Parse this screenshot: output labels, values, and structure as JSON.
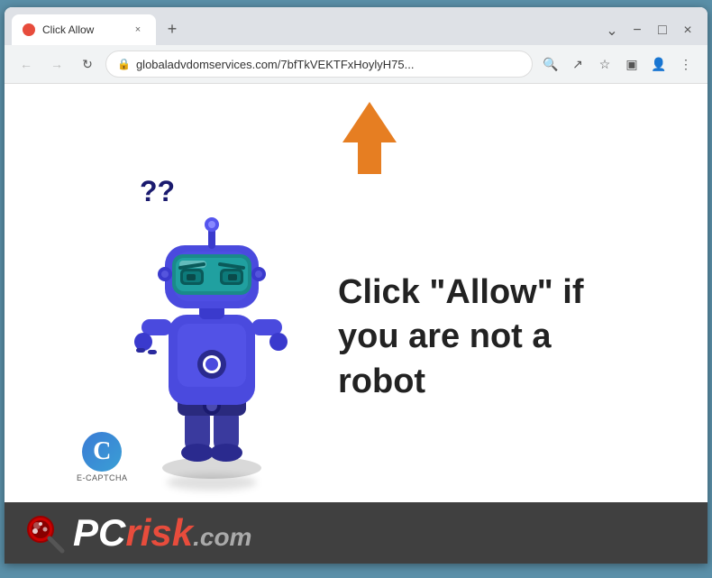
{
  "browser": {
    "tab": {
      "favicon_color": "#e74c3c",
      "title": "Click Allow",
      "close_label": "×"
    },
    "new_tab_label": "+",
    "window_controls": {
      "chevron": "⌄",
      "minimize": "−",
      "maximize": "□",
      "close": "×"
    },
    "nav": {
      "back_label": "←",
      "forward_label": "→",
      "reload_label": "↻"
    },
    "address": {
      "url": "globaladvdomservices.com/7bfTkVEKTFxHoylyH75...",
      "lock_symbol": "🔒"
    },
    "toolbar_icons": {
      "search": "🔍",
      "share": "↗",
      "bookmark": "☆",
      "extension": "□",
      "profile": "👤",
      "menu": "⋮"
    }
  },
  "page": {
    "question_marks": "??",
    "captcha_text": "Click \"Allow\" if you are not a robot",
    "ecaptcha_letter": "C",
    "ecaptcha_label": "E-CAPTCHA"
  },
  "watermark": {
    "pc_text": "PC",
    "risk_text": "risk",
    "com_text": ".com"
  }
}
